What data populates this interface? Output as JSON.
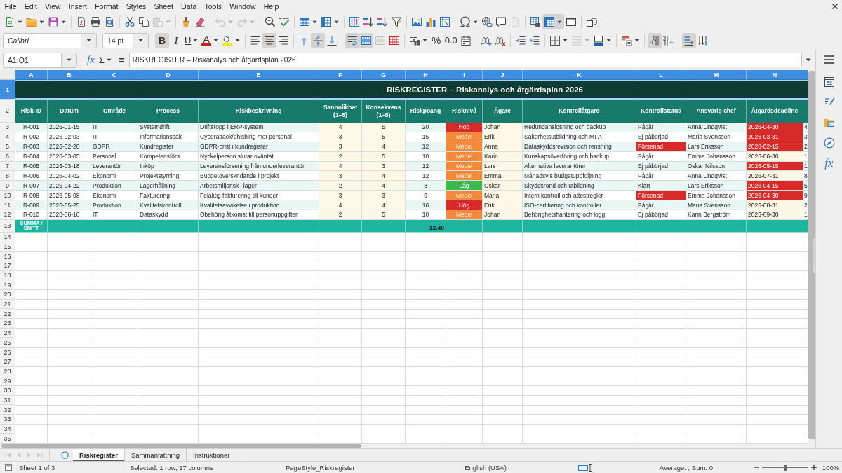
{
  "menu_bar": [
    "File",
    "Edit",
    "View",
    "Insert",
    "Format",
    "Styles",
    "Sheet",
    "Data",
    "Tools",
    "Window",
    "Help"
  ],
  "standard_toolbar": [
    {
      "kind": "new",
      "disabled": false,
      "on": false
    },
    {
      "kind": "open",
      "disabled": false,
      "on": false
    },
    {
      "kind": "save",
      "disabled": false,
      "on": false
    },
    {
      "kind": "pdf",
      "disabled": false,
      "on": false
    },
    {
      "kind": "print",
      "disabled": false,
      "on": false
    },
    {
      "kind": "preview",
      "disabled": false,
      "on": false
    },
    {
      "kind": "cut",
      "disabled": false,
      "on": false
    },
    {
      "kind": "copy",
      "disabled": false,
      "on": false
    },
    {
      "kind": "paste",
      "disabled": true,
      "on": false
    },
    {
      "kind": "brush",
      "disabled": false,
      "on": false
    },
    {
      "kind": "eraser",
      "disabled": false,
      "on": false
    },
    {
      "kind": "undo",
      "disabled": true,
      "on": false
    },
    {
      "kind": "redo",
      "disabled": true,
      "on": false
    },
    {
      "kind": "find",
      "disabled": false,
      "on": false
    },
    {
      "kind": "spelling",
      "disabled": false,
      "on": false
    },
    {
      "kind": "rows",
      "disabled": false,
      "on": false
    },
    {
      "kind": "columns",
      "disabled": false,
      "on": false
    },
    {
      "kind": "sort",
      "disabled": false,
      "on": false
    },
    {
      "kind": "ascending",
      "disabled": false,
      "on": false
    },
    {
      "kind": "descending",
      "disabled": false,
      "on": false
    },
    {
      "kind": "filter",
      "disabled": false,
      "on": false
    },
    {
      "kind": "image",
      "disabled": false,
      "on": false
    },
    {
      "kind": "chart",
      "disabled": false,
      "on": false
    },
    {
      "kind": "pivot",
      "disabled": false,
      "on": false
    },
    {
      "kind": "symbol",
      "disabled": false,
      "on": false
    },
    {
      "kind": "hyperlink",
      "disabled": false,
      "on": false
    },
    {
      "kind": "comment",
      "disabled": false,
      "on": false
    },
    {
      "kind": "headers",
      "disabled": true,
      "on": false
    },
    {
      "kind": "printarea",
      "disabled": false,
      "on": false
    },
    {
      "kind": "freeze",
      "disabled": false,
      "on": true
    },
    {
      "kind": "split",
      "disabled": false,
      "on": false
    },
    {
      "kind": "shapes",
      "disabled": false,
      "on": false
    }
  ],
  "format_toolbar": {
    "font_name": "Calibri",
    "font_size": "14 pt",
    "buttons": [
      {
        "kind": "bold",
        "glyph": "B",
        "disabled": false,
        "on": true
      },
      {
        "kind": "italic",
        "glyph": "I",
        "disabled": false,
        "on": false
      },
      {
        "kind": "underline",
        "glyph": "U",
        "disabled": false,
        "on": false
      },
      {
        "kind": "fontcolor",
        "glyph": "A",
        "disabled": false,
        "on": false
      },
      {
        "kind": "highlight",
        "disabled": false,
        "on": false
      },
      {
        "kind": "left",
        "disabled": false,
        "on": false
      },
      {
        "kind": "center",
        "disabled": false,
        "on": true
      },
      {
        "kind": "right",
        "disabled": false,
        "on": false
      },
      {
        "kind": "top",
        "disabled": false,
        "on": false
      },
      {
        "kind": "middle",
        "disabled": false,
        "on": true
      },
      {
        "kind": "bottom",
        "disabled": false,
        "on": false
      },
      {
        "kind": "wrap",
        "disabled": false,
        "on": true
      },
      {
        "kind": "mergecenter",
        "disabled": false,
        "on": true
      },
      {
        "kind": "merge",
        "disabled": true,
        "on": false
      },
      {
        "kind": "unmerge",
        "disabled": false,
        "on": false
      },
      {
        "kind": "currency",
        "disabled": false,
        "on": false
      },
      {
        "kind": "percent",
        "glyph": "%",
        "disabled": false,
        "on": false
      },
      {
        "kind": "number",
        "glyph": "0.0",
        "disabled": false,
        "on": false
      },
      {
        "kind": "date",
        "disabled": false,
        "on": false
      },
      {
        "kind": "adddecimal",
        "disabled": false,
        "on": false
      },
      {
        "kind": "deletedecimal",
        "disabled": false,
        "on": false
      },
      {
        "kind": "indent",
        "disabled": false,
        "on": false
      },
      {
        "kind": "outdent",
        "disabled": false,
        "on": false
      },
      {
        "kind": "borders",
        "disabled": false,
        "on": false
      },
      {
        "kind": "borderstyle",
        "disabled": true,
        "on": false
      },
      {
        "kind": "bordercolor",
        "disabled": false,
        "on": false
      },
      {
        "kind": "conditional",
        "disabled": false,
        "on": false
      },
      {
        "kind": "ltr",
        "disabled": false,
        "on": true
      },
      {
        "kind": "rtl",
        "disabled": false,
        "on": false
      },
      {
        "kind": "horizontal",
        "disabled": false,
        "on": true
      },
      {
        "kind": "vertical",
        "disabled": false,
        "on": false
      }
    ]
  },
  "formula_bar": {
    "name_box": "A1:Q1",
    "function_wizard": "fx",
    "sum": "Σ",
    "equals": "=",
    "content": "RISKREGISTER – Riskanalys och åtgärdsplan 2026"
  },
  "sheet": {
    "column_headers": [
      {
        "label": "A",
        "selected": true
      },
      {
        "label": "B",
        "selected": true
      },
      {
        "label": "C",
        "selected": true
      },
      {
        "label": "D",
        "selected": true
      },
      {
        "label": "E",
        "selected": true
      },
      {
        "label": "F",
        "selected": true
      },
      {
        "label": "G",
        "selected": true
      },
      {
        "label": "H",
        "selected": true
      },
      {
        "label": "I",
        "selected": true
      },
      {
        "label": "J",
        "selected": true
      },
      {
        "label": "K",
        "selected": true
      },
      {
        "label": "L",
        "selected": true
      },
      {
        "label": "M",
        "selected": true
      },
      {
        "label": "N",
        "selected": true
      },
      {
        "selected": true
      }
    ],
    "row_headers": [
      {
        "label": "1",
        "selected": true
      },
      {
        "label": "2",
        "selected": false
      },
      {
        "label": "3",
        "selected": false
      },
      {
        "label": "4",
        "selected": false
      },
      {
        "label": "5",
        "selected": false
      },
      {
        "label": "6",
        "selected": false
      },
      {
        "label": "7",
        "selected": false
      },
      {
        "label": "8",
        "selected": false
      },
      {
        "label": "9",
        "selected": false
      },
      {
        "label": "10",
        "selected": false
      },
      {
        "label": "11",
        "selected": false
      },
      {
        "label": "12",
        "selected": false
      },
      {
        "label": "13",
        "selected": false
      },
      {
        "label": "14",
        "selected": false
      },
      {
        "label": "15",
        "selected": false
      },
      {
        "label": "16",
        "selected": false
      },
      {
        "label": "17",
        "selected": false
      },
      {
        "label": "18",
        "selected": false
      },
      {
        "label": "19",
        "selected": false
      },
      {
        "label": "20",
        "selected": false
      },
      {
        "label": "21",
        "selected": false
      },
      {
        "label": "22",
        "selected": false
      },
      {
        "label": "23",
        "selected": false
      },
      {
        "label": "24",
        "selected": false
      },
      {
        "label": "25",
        "selected": false
      },
      {
        "label": "26",
        "selected": false
      },
      {
        "label": "27",
        "selected": false
      },
      {
        "label": "28",
        "selected": false
      },
      {
        "label": "29",
        "selected": false
      },
      {
        "label": "30",
        "selected": false
      },
      {
        "label": "31",
        "selected": false
      },
      {
        "label": "32",
        "selected": false
      },
      {
        "label": "33",
        "selected": false
      },
      {
        "label": "34",
        "selected": false
      },
      {
        "label": "35",
        "selected": false
      }
    ],
    "title": "RISKREGISTER – Riskanalys och åtgärdsplan 2026",
    "headings": [
      "Risk-ID",
      "Datum",
      "Område",
      "Process",
      "Riskbeskrivning",
      "Sannolikhet (1–5)",
      "Konsekvens (1–5)",
      "Riskpoäng",
      "Risknivå",
      "Ägare",
      "Kontrollåtgärd",
      "Kontrollstatus",
      "Ansvarig chef",
      "Åtgärdsdeadline"
    ],
    "rows": [
      {
        "cells": [
          {
            "text": "R-001"
          },
          {
            "text": "2026-01-15"
          },
          {
            "text": "IT"
          },
          {
            "text": "Systemdrift"
          },
          {
            "text": "Driftstopp i ERP-system"
          },
          {
            "text": "4"
          },
          {
            "text": "5"
          },
          {
            "text": "20"
          },
          {
            "text": "Hög",
            "color": "#d92a2a"
          },
          {
            "text": "Johan"
          },
          {
            "text": "Redundanslösning och backup"
          },
          {
            "text": "Pågår"
          },
          {
            "text": "Anna Lindqvist"
          },
          {
            "text": "2026-04-30",
            "color": "#d92a2a"
          },
          {
            "text": "4"
          }
        ]
      },
      {
        "cells": [
          {
            "text": "R-002"
          },
          {
            "text": "2026-02-03"
          },
          {
            "text": "IT"
          },
          {
            "text": "Informationssäk"
          },
          {
            "text": "Cyberattack/phishing mot personal"
          },
          {
            "text": "3"
          },
          {
            "text": "5"
          },
          {
            "text": "15"
          },
          {
            "text": "Medel",
            "color": "#f5893a"
          },
          {
            "text": "Erik"
          },
          {
            "text": "Säkerhetsutbildning och MFA"
          },
          {
            "text": "Ej påbörjad"
          },
          {
            "text": "Maria Svensson"
          },
          {
            "text": "2026-03-31",
            "color": "#d92a2a"
          },
          {
            "text": "3"
          }
        ]
      },
      {
        "cells": [
          {
            "text": "R-003"
          },
          {
            "text": "2026-02-20"
          },
          {
            "text": "GDPR"
          },
          {
            "text": "Kundregister"
          },
          {
            "text": "GDPR-brist i kundregister"
          },
          {
            "text": "3"
          },
          {
            "text": "4"
          },
          {
            "text": "12"
          },
          {
            "text": "Medel",
            "color": "#f5893a"
          },
          {
            "text": "Anna"
          },
          {
            "text": "Dataskyddsrevision och rensning"
          },
          {
            "text": "Försenad",
            "color": "#d92a2a"
          },
          {
            "text": "Lars Eriksson"
          },
          {
            "text": "2026-02-15",
            "color": "#d92a2a"
          },
          {
            "text": "2"
          }
        ]
      },
      {
        "cells": [
          {
            "text": "R-004"
          },
          {
            "text": "2026-03-05"
          },
          {
            "text": "Personal"
          },
          {
            "text": "Kompetensförs"
          },
          {
            "text": "Nyckelperson slutar oväntat"
          },
          {
            "text": "2"
          },
          {
            "text": "5"
          },
          {
            "text": "10"
          },
          {
            "text": "Medel",
            "color": "#f5893a"
          },
          {
            "text": "Karin"
          },
          {
            "text": "Kunskapsöverföring och backup"
          },
          {
            "text": "Pågår"
          },
          {
            "text": "Emma Johansson"
          },
          {
            "text": "2026-06-30"
          },
          {
            "text": "1"
          }
        ]
      },
      {
        "cells": [
          {
            "text": "R-005"
          },
          {
            "text": "2026-03-18"
          },
          {
            "text": "Leverantör"
          },
          {
            "text": "Inköp"
          },
          {
            "text": "Leveransförsening från underleverantör"
          },
          {
            "text": "4"
          },
          {
            "text": "3"
          },
          {
            "text": "12"
          },
          {
            "text": "Medel",
            "color": "#f5893a"
          },
          {
            "text": "Lars"
          },
          {
            "text": "Alternativa leverantörer"
          },
          {
            "text": "Ej påbörjad"
          },
          {
            "text": "Oskar Nilsson"
          },
          {
            "text": "2026-05-15",
            "color": "#d92a2a"
          },
          {
            "text": "1"
          }
        ]
      },
      {
        "cells": [
          {
            "text": "R-006"
          },
          {
            "text": "2026-04-02"
          },
          {
            "text": "Ekonomi"
          },
          {
            "text": "Projektstyrning"
          },
          {
            "text": "Budgetöverskridande i projekt"
          },
          {
            "text": "3"
          },
          {
            "text": "4"
          },
          {
            "text": "12"
          },
          {
            "text": "Medel",
            "color": "#f5893a"
          },
          {
            "text": "Emma"
          },
          {
            "text": "Månadsvis budgetuppföljning"
          },
          {
            "text": "Pågår"
          },
          {
            "text": "Anna Lindqvist"
          },
          {
            "text": "2026-07-31"
          },
          {
            "text": "8"
          }
        ]
      },
      {
        "cells": [
          {
            "text": "R-007"
          },
          {
            "text": "2026-04-22"
          },
          {
            "text": "Produktion"
          },
          {
            "text": "Lagerhållning"
          },
          {
            "text": "Arbetsmiljörisk i lager"
          },
          {
            "text": "2"
          },
          {
            "text": "4"
          },
          {
            "text": "8"
          },
          {
            "text": "Låg",
            "color": "#3cb94e"
          },
          {
            "text": "Oskar"
          },
          {
            "text": "Skyddsrond och utbildning"
          },
          {
            "text": "Klart"
          },
          {
            "text": "Lars Eriksson"
          },
          {
            "text": "2026-04-15",
            "color": "#d92a2a"
          },
          {
            "text": "5"
          }
        ]
      },
      {
        "cells": [
          {
            "text": "R-008"
          },
          {
            "text": "2026-05-08"
          },
          {
            "text": "Ekonomi"
          },
          {
            "text": "Fakturering"
          },
          {
            "text": "Felaktig fakturering till kunder"
          },
          {
            "text": "3"
          },
          {
            "text": "3"
          },
          {
            "text": "9"
          },
          {
            "text": "Medel",
            "color": "#f5893a"
          },
          {
            "text": "Maria"
          },
          {
            "text": "Intern kontroll och attestregler"
          },
          {
            "text": "Försenad",
            "color": "#d92a2a"
          },
          {
            "text": "Emma Johansson"
          },
          {
            "text": "2026-04-30",
            "color": "#d92a2a"
          },
          {
            "text": "9"
          }
        ]
      },
      {
        "cells": [
          {
            "text": "R-009"
          },
          {
            "text": "2026-05-25"
          },
          {
            "text": "Produktion"
          },
          {
            "text": "Kvalitetskontroll"
          },
          {
            "text": "Kvalitetsavvikelse i produktion"
          },
          {
            "text": "4"
          },
          {
            "text": "4"
          },
          {
            "text": "16"
          },
          {
            "text": "Hög",
            "color": "#d92a2a"
          },
          {
            "text": "Erik"
          },
          {
            "text": "ISO-certifiering och kontroller"
          },
          {
            "text": "Pågår"
          },
          {
            "text": "Maria Svensson"
          },
          {
            "text": "2026-08-31"
          },
          {
            "text": "2"
          }
        ]
      },
      {
        "cells": [
          {
            "text": "R-010"
          },
          {
            "text": "2026-06-10"
          },
          {
            "text": "IT"
          },
          {
            "text": "Dataskydd"
          },
          {
            "text": "Obehörig åtkomst till personuppgifter"
          },
          {
            "text": "2"
          },
          {
            "text": "5"
          },
          {
            "text": "10"
          },
          {
            "text": "Medel",
            "color": "#f5893a"
          },
          {
            "text": "Johan"
          },
          {
            "text": "Behörighetshantering och logg"
          },
          {
            "text": "Ej påbörjad"
          },
          {
            "text": "Karin Bergström"
          },
          {
            "text": "2026-09-30"
          },
          {
            "text": "1"
          }
        ]
      }
    ],
    "summary": {
      "label": "SUMMA / SNITT",
      "average": "12.40"
    }
  },
  "sidebar": [
    {
      "kind": "properties",
      "selected": false
    },
    {
      "kind": "styles",
      "selected": false
    },
    {
      "kind": "gallery",
      "selected": false
    },
    {
      "kind": "navigator",
      "selected": false
    },
    {
      "kind": "functions",
      "glyph": "fx",
      "selected": false
    }
  ],
  "sheet_tabs": {
    "navigation": [
      {
        "kind": "first",
        "disabled": true
      },
      {
        "kind": "previous",
        "disabled": true
      },
      {
        "kind": "next",
        "disabled": true
      },
      {
        "kind": "last",
        "disabled": true
      }
    ],
    "tabs": [
      {
        "label": "Riskregister",
        "selected": true
      },
      {
        "label": "Sammanfattning",
        "selected": false
      },
      {
        "label": "Instruktioner",
        "selected": false
      }
    ]
  },
  "status_bar": {
    "sheet": "Sheet 1 of 3",
    "selection": "Selected: 1 row, 17 columns",
    "page_style": "PageStyle_Riskregister",
    "language": "English (USA)",
    "statistics": "Average: ; Sum: 0",
    "zoom": {
      "level": 0.5,
      "reading": "100%"
    }
  }
}
